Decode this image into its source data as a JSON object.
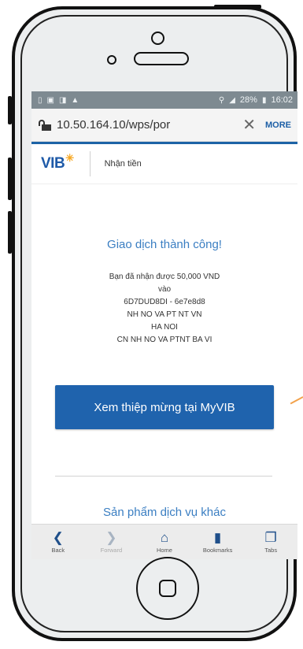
{
  "status_bar": {
    "right_text": "28%",
    "time": "16:02"
  },
  "browser": {
    "url": "10.50.164.10/wps/por",
    "more_label": "MORE"
  },
  "app_header": {
    "logo_text": "VIB",
    "title": "Nhận tiền"
  },
  "transaction": {
    "success_title": "Giao dịch thành công!",
    "lines": [
      "Bạn đã nhận được 50,000 VND",
      "vào",
      "6D7DUD8DI - 6e7e8d8",
      "NH NO VA PT NT VN",
      "HA NOI",
      "CN NH NO VA PTNT BA VI"
    ],
    "cta_label": "Xem thiệp mừng tại MyVIB"
  },
  "other_products_label": "Sản phẩm dịch vụ khác",
  "bottom_nav": [
    {
      "label": "Back",
      "icon": "chevron-left-icon"
    },
    {
      "label": "Forward",
      "icon": "chevron-right-icon"
    },
    {
      "label": "Home",
      "icon": "house-icon"
    },
    {
      "label": "Bookmarks",
      "icon": "bookmark-icon"
    },
    {
      "label": "Tabs",
      "icon": "tabs-icon"
    }
  ],
  "colors": {
    "brand_blue": "#1f63ad",
    "status_bar": "#7e8a91",
    "accent_orange": "#f2a24c"
  }
}
